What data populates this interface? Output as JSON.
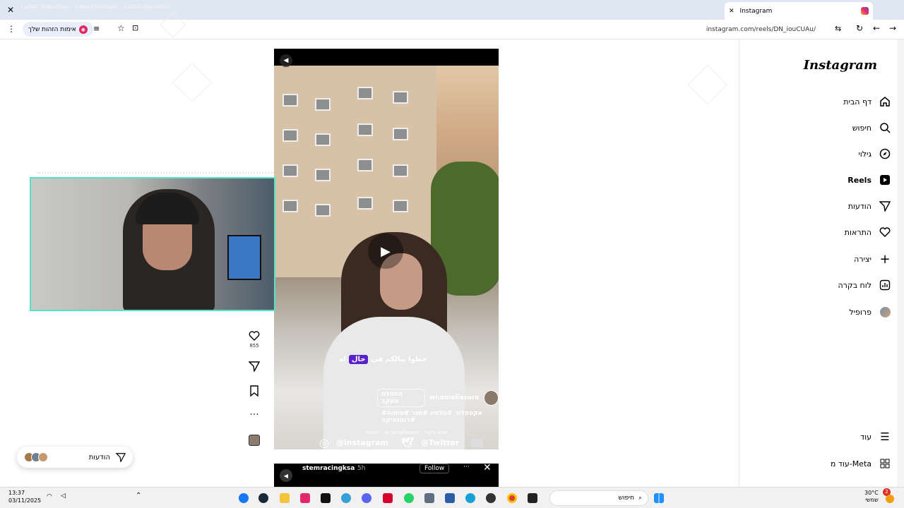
{
  "browser": {
    "tab_title": "Instagram",
    "url": "instagram.com/reels/DN_iouCUAu/",
    "pill_label": "אימות הזהות שלך"
  },
  "instagram": {
    "brand": "Instagram",
    "nav": [
      {
        "label": "דף הבית",
        "icon": "home-icon"
      },
      {
        "label": "חיפוש",
        "icon": "search-icon"
      },
      {
        "label": "גילוי",
        "icon": "compass-icon"
      },
      {
        "label": "Reels",
        "icon": "reels-icon"
      },
      {
        "label": "הודעות",
        "icon": "messenger-icon"
      },
      {
        "label": "התראות",
        "icon": "heart-icon"
      },
      {
        "label": "יצירה",
        "icon": "plus-icon"
      },
      {
        "label": "לוח בקרה",
        "icon": "dashboard-icon"
      },
      {
        "label": "פרופיל",
        "icon": "avatar"
      }
    ],
    "more_label": "עוד",
    "meta_label": "עוד מ-Meta"
  },
  "reel": {
    "caption_before": "خطوا بيالكم في",
    "caption_highlight": "حال",
    "caption_after": "له",
    "author": "wr.amaliasara",
    "follow_chip": "התחלת מעקב",
    "hashtags": "#אקספלור #הלחיג #סגר #סיחוה #רומנטיקה",
    "meta_line": "wr.amaliasara · שמע מקורי",
    "meta_location": "תמנית",
    "likes": "855"
  },
  "social_bar": {
    "instagram": "@instagram",
    "twitter": "@Twitter"
  },
  "reel2": {
    "author": "stemracingksa",
    "time": "5h",
    "follow": "Follow"
  },
  "notifications": {
    "label": "הודעות"
  },
  "taskbar": {
    "time": "13:37",
    "date": "03/11/2025",
    "search": "חיפוש",
    "weather": "30°C",
    "weather_sub": "שמשי",
    "badge": "2"
  }
}
